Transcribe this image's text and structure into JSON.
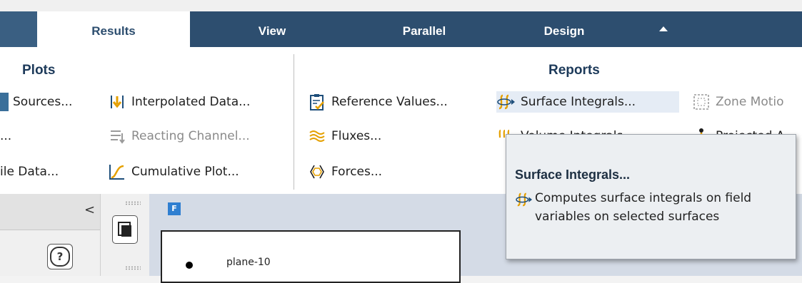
{
  "tabs": [
    {
      "label": "Results",
      "active": true
    },
    {
      "label": "View"
    },
    {
      "label": "Parallel"
    },
    {
      "label": "Design"
    }
  ],
  "groups": {
    "plots": "Plots",
    "reports": "Reports"
  },
  "plots_buttons": {
    "sources": "Sources...",
    "dots": "...",
    "file_data": "ile Data...",
    "interpolated": "Interpolated Data...",
    "reacting": "Reacting Channel...",
    "cumulative": "Cumulative Plot..."
  },
  "reports_buttons": {
    "reference": "Reference Values...",
    "fluxes": "Fluxes...",
    "forces": "Forces...",
    "surface_integrals": "Surface Integrals...",
    "volume_integrals": "Volume Integrals...",
    "zone_motion": "Zone Motio",
    "projected": "Projected A"
  },
  "tooltip": {
    "title": "Surface Integrals...",
    "body": "Computes surface integrals on field variables on selected surfaces"
  },
  "graphics": {
    "badge": "F",
    "legend_item": "plane-10"
  },
  "left_panel": {
    "collapse": "<",
    "help": "?"
  },
  "colors": {
    "tabbar": "#2d4e6f",
    "accent_orange": "#e5a000",
    "highlight": "#e5ecf5"
  }
}
